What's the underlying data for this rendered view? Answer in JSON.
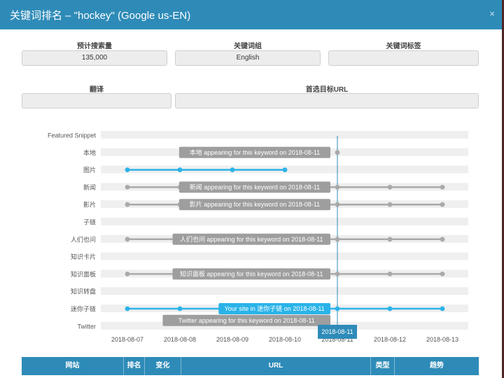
{
  "modal": {
    "title": "关键词排名 – \"hockey\" (Google us-EN)",
    "close_glyph": "×"
  },
  "fields": {
    "search_volume_label": "预计搜索量",
    "search_volume_value": "135,000",
    "keyword_group_label": "关键词组",
    "keyword_group_value": "English",
    "keyword_tags_label": "关键词标签",
    "keyword_tags_value": "",
    "translation_label": "翻译",
    "translation_value": "",
    "preferred_url_label": "首选目标URL",
    "preferred_url_value": ""
  },
  "chart_data": {
    "type": "timeline",
    "dates": [
      "2018-08-07",
      "2018-08-08",
      "2018-08-09",
      "2018-08-10",
      "2018-08-11",
      "2018-08-12",
      "2018-08-13"
    ],
    "rows": [
      {
        "label": "Featured Snippet",
        "present": [],
        "color": "gray"
      },
      {
        "label": "本地",
        "present": [
          "2018-08-11"
        ],
        "color": "gray",
        "tooltip": "本地 appearing for this keyword on 2018-08-11"
      },
      {
        "label": "图片",
        "present": [
          "2018-08-07",
          "2018-08-08",
          "2018-08-09",
          "2018-08-10"
        ],
        "color": "blue"
      },
      {
        "label": "新闻",
        "present": [
          "2018-08-07",
          "2018-08-08",
          "2018-08-09",
          "2018-08-10",
          "2018-08-11",
          "2018-08-12",
          "2018-08-13"
        ],
        "color": "gray",
        "tooltip": "新闻 appearing for this keyword on 2018-08-11"
      },
      {
        "label": "影片",
        "present": [
          "2018-08-07",
          "2018-08-08",
          "2018-08-09",
          "2018-08-10",
          "2018-08-11",
          "2018-08-12",
          "2018-08-13"
        ],
        "color": "gray",
        "tooltip": "影片 appearing for this keyword on 2018-08-11"
      },
      {
        "label": "子链",
        "present": [],
        "color": "gray"
      },
      {
        "label": "人们也问",
        "present": [
          "2018-08-07",
          "2018-08-08",
          "2018-08-09",
          "2018-08-10",
          "2018-08-11",
          "2018-08-12",
          "2018-08-13"
        ],
        "color": "gray",
        "tooltip": "人们也问 appearing for this keyword on 2018-08-11"
      },
      {
        "label": "知识卡片",
        "present": [],
        "color": "gray"
      },
      {
        "label": "知识面板",
        "present": [
          "2018-08-07",
          "2018-08-08",
          "2018-08-09",
          "2018-08-10",
          "2018-08-11",
          "2018-08-12",
          "2018-08-13"
        ],
        "color": "gray",
        "tooltip": "知识面板 appearing for this keyword on 2018-08-11"
      },
      {
        "label": "知识转盘",
        "present": [],
        "color": "gray"
      },
      {
        "label": "迷你子链",
        "present": [
          "2018-08-07",
          "2018-08-08",
          "2018-08-09",
          "2018-08-10",
          "2018-08-11",
          "2018-08-12",
          "2018-08-13"
        ],
        "color": "blue",
        "tooltip": "Your site in 迷你子链 on 2018-08-11"
      },
      {
        "label": "Twitter",
        "present": [],
        "color": "gray",
        "tooltip": "Twitter appearing for this keyword on 2018-08-11"
      }
    ],
    "hover_date": "2018-08-11",
    "colors": {
      "blue": "#2ab3e8",
      "gray": "#a9a9a9",
      "band": "#efefef",
      "tooltip_gray": "#9e9e9e",
      "tooltip_blue": "#2ab3e8",
      "crosshair": "#2e8bb8",
      "date_badge": "#2e8bb8"
    }
  },
  "table": {
    "headers": [
      "网站",
      "排名",
      "变化",
      "URL",
      "类型",
      "趋势"
    ]
  },
  "colors": {
    "header": "#2e8bb8",
    "backdrop": "#5a2b2b"
  }
}
